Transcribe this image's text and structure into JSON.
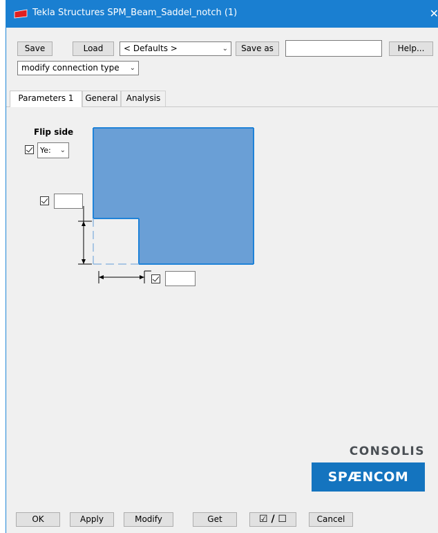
{
  "titlebar": {
    "title": "Tekla Structures  SPM_Beam_Saddel_notch (1)",
    "close": "✕"
  },
  "toolbar": {
    "save_label": "Save",
    "load_label": "Load",
    "defaults_value": "< Defaults >",
    "save_as_label": "Save as",
    "save_as_value": "",
    "help_label": "Help...",
    "connection_type_value": "modify connection type"
  },
  "tabs": [
    "Parameters 1",
    "General",
    "Analysis"
  ],
  "parameters": {
    "flip_side_label": "Flip side",
    "flip_side_value": "Ye:",
    "notch_height_value": "",
    "notch_length_value": ""
  },
  "logo": {
    "line1": "CONSOLIS",
    "line2": "SPÆNCOM"
  },
  "footer": {
    "ok_label": "OK",
    "apply_label": "Apply",
    "modify_label": "Modify",
    "get_label": "Get",
    "toggle_label": "☑ / ☐",
    "cancel_label": "Cancel"
  },
  "colors": {
    "titlebar": "#1a7fd1",
    "beam_fill": "#6a9fd6",
    "beam_edge": "#1e82d8",
    "logo_blue": "#1474bf"
  }
}
